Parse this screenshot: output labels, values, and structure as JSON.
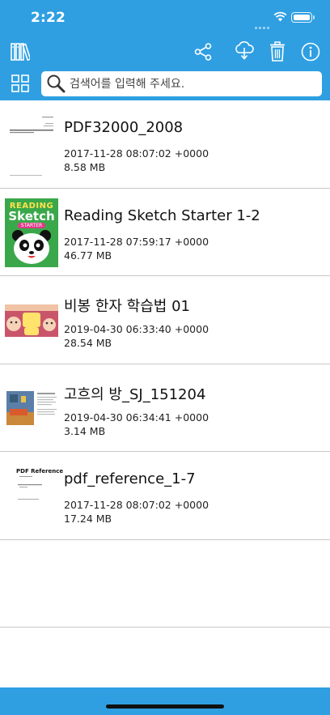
{
  "status_bar": {
    "time": "2:22"
  },
  "toolbar": {
    "library_icon": "library-icon",
    "share_icon": "share-icon",
    "download_icon": "cloud-download-icon",
    "trash_icon": "trash-icon",
    "info_icon": "info-icon",
    "grid_icon": "grid-view-icon"
  },
  "search": {
    "placeholder": "검색어를 입력해 주세요.",
    "value": ""
  },
  "files": [
    {
      "title": "PDF32000_2008",
      "date": "2017-11-28 08:07:02 +0000",
      "size": "8.58 MB"
    },
    {
      "title": "Reading Sketch Starter 1-2",
      "date": "2017-11-28 07:59:17 +0000",
      "size": "46.77 MB",
      "cover_text_1": "READING",
      "cover_text_2": "Sketch",
      "cover_text_3": "STARTER"
    },
    {
      "title": "비봉 한자 학습법 01",
      "date": "2019-04-30 06:33:40 +0000",
      "size": "28.54 MB"
    },
    {
      "title": "고흐의 방_SJ_151204",
      "date": "2019-04-30 06:34:41 +0000",
      "size": "3.14 MB"
    },
    {
      "title": "pdf_reference_1-7",
      "date": "2017-11-28 08:07:02 +0000",
      "size": "17.24 MB",
      "cover_text_1": "PDF Reference"
    }
  ],
  "colors": {
    "accent": "#2f9fe2",
    "divider": "#c8c8c8"
  }
}
